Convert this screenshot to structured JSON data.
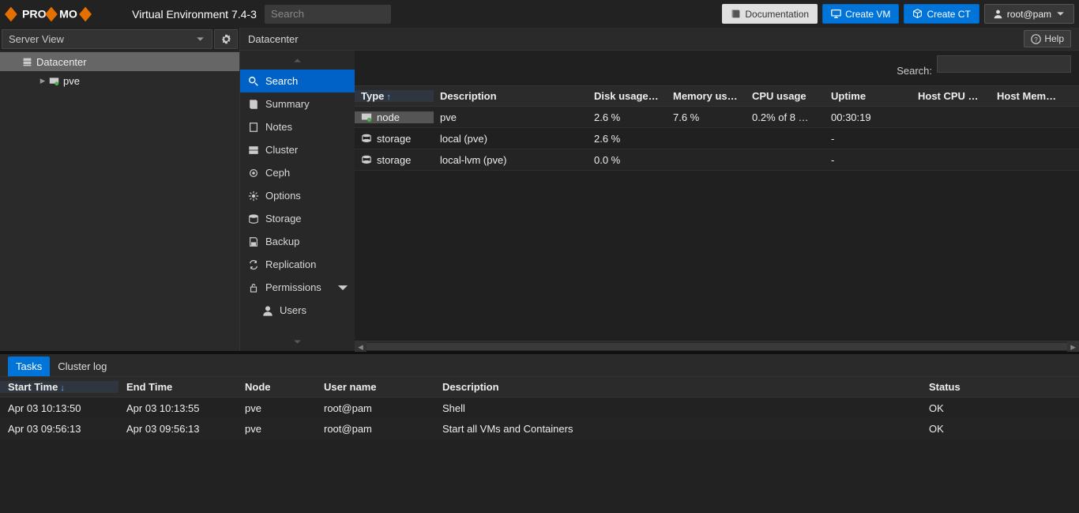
{
  "header": {
    "product": "Virtual Environment 7.4-3",
    "search_placeholder": "Search",
    "buttons": {
      "doc": "Documentation",
      "create_vm": "Create VM",
      "create_ct": "Create CT",
      "user": "root@pam"
    }
  },
  "sidebar": {
    "view_label": "Server View",
    "tree": {
      "datacenter": "Datacenter",
      "node": "pve"
    }
  },
  "center": {
    "title": "Datacenter",
    "help": "Help",
    "menu": [
      "Search",
      "Summary",
      "Notes",
      "Cluster",
      "Ceph",
      "Options",
      "Storage",
      "Backup",
      "Replication",
      "Permissions",
      "Users"
    ],
    "grid": {
      "search_label": "Search:",
      "columns": {
        "type": "Type",
        "desc": "Description",
        "disk": "Disk usage…",
        "mem": "Memory us…",
        "cpu": "CPU usage",
        "uptime": "Uptime",
        "hcpu": "Host CPU …",
        "hmem": "Host Mem…"
      },
      "rows": [
        {
          "type": "node",
          "desc": "pve",
          "disk": "2.6 %",
          "mem": "7.6 %",
          "cpu": "0.2% of 8 …",
          "uptime": "00:30:19"
        },
        {
          "type": "storage",
          "desc": "local (pve)",
          "disk": "2.6 %",
          "mem": "",
          "cpu": "",
          "uptime": "-"
        },
        {
          "type": "storage",
          "desc": "local-lvm (pve)",
          "disk": "0.0 %",
          "mem": "",
          "cpu": "",
          "uptime": "-"
        }
      ]
    }
  },
  "bottom": {
    "tabs": {
      "tasks": "Tasks",
      "cluster_log": "Cluster log"
    },
    "columns": {
      "start": "Start Time",
      "end": "End Time",
      "node": "Node",
      "user": "User name",
      "desc": "Description",
      "status": "Status"
    },
    "rows": [
      {
        "start": "Apr 03 10:13:50",
        "end": "Apr 03 10:13:55",
        "node": "pve",
        "user": "root@pam",
        "desc": "Shell",
        "status": "OK"
      },
      {
        "start": "Apr 03 09:56:13",
        "end": "Apr 03 09:56:13",
        "node": "pve",
        "user": "root@pam",
        "desc": "Start all VMs and Containers",
        "status": "OK"
      }
    ]
  }
}
